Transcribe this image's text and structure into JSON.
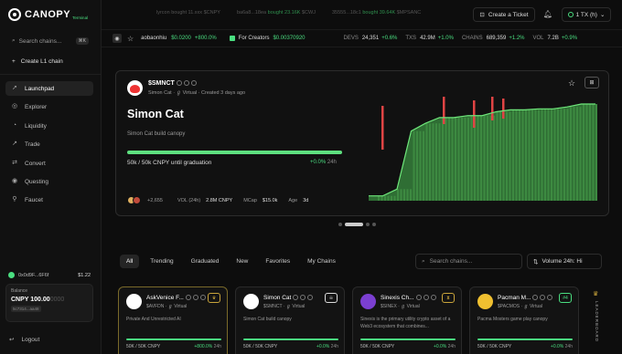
{
  "app": {
    "name": "CANOPY",
    "sub": "Terminal"
  },
  "sidebar": {
    "search_placeholder": "Search chains...",
    "search_shortcut": "⌘K",
    "create_label": "Create L1 chain",
    "items": [
      {
        "label": "Launchpad",
        "icon": "rocket-icon",
        "active": true
      },
      {
        "label": "Explorer",
        "icon": "globe-icon"
      },
      {
        "label": "Liquidity",
        "icon": "drop-icon"
      },
      {
        "label": "Trade",
        "icon": "trend-icon"
      },
      {
        "label": "Convert",
        "icon": "swap-icon"
      },
      {
        "label": "Questing",
        "icon": "target-icon"
      },
      {
        "label": "Faucet",
        "icon": "faucet-icon"
      }
    ],
    "wallet": {
      "address": "0x0d9F...6F6f",
      "balance_usd": "$1.22",
      "balance_label": "Balance",
      "balance_value": "CNPY 100.00",
      "balance_faded": "0000",
      "addr_short": "5c7314...aa48"
    },
    "logout_label": "Logout"
  },
  "ticker": [
    {
      "left": "lyrcon bought 11.xxx $CNPY",
      "right": ""
    },
    {
      "left": "ba6a8...18ea",
      "bought": "bought 23.16K",
      "sym": "$CWJ"
    },
    {
      "left": "35555...18c1",
      "bought": "bought 39.64K",
      "sym": "$MPSANC"
    }
  ],
  "header": {
    "ticket_label": "Create a Ticket",
    "tx_label": "1 TX (h)",
    "tx_caret": "⌄"
  },
  "statbar": {
    "user": "aobaonhiu",
    "user_price": "$0.0200",
    "user_change": "+800.0%",
    "creators_label": "For Creators",
    "creators_price": "$0.00370920",
    "devs_label": "DEVS",
    "devs_val": "24,351",
    "devs_chg": "+0.6%",
    "txs_label": "TXS",
    "txs_val": "42.9M",
    "txs_chg": "+1.0%",
    "chains_label": "CHAINS",
    "chains_val": "689,359",
    "chains_chg": "+1.2%",
    "vol_label": "VOL",
    "vol_val": "7.2B",
    "vol_chg": "+0.9%"
  },
  "featured": {
    "symbol": "$SMNCT",
    "creator": "Simon Cat",
    "virtual_label": "Virtual",
    "created": "Created 3 days ago",
    "name": "Simon Cat",
    "description": "Simon Cat build canopy",
    "progress": 1.0,
    "progress_text": "50k / 50k CNPY until graduation",
    "change_text": "+0.0%",
    "change_period": "24h",
    "holders": "+2,655",
    "vol_label": "VOL (24h)",
    "vol_val": "2.8M CNPY",
    "mcap_label": "MCap",
    "mcap_val": "$15.0k",
    "age_label": "Age",
    "age_val": "3d"
  },
  "filters": {
    "tabs": [
      "All",
      "Trending",
      "Graduated",
      "New",
      "Favorites",
      "My Chains"
    ],
    "active": 0,
    "search_placeholder": "Search chains...",
    "sort_label": "Volume 24h: Hi"
  },
  "cards": [
    {
      "name": "AskVenice F...",
      "symbol": "$AVFDN",
      "virtual": "Virtual",
      "desc": "Private And Unrestricted AI",
      "progress_text": "50K / 50K CNPY",
      "change": "+800.0%",
      "period": "24h",
      "progress": 1.0,
      "badge": "crown-icon",
      "badge_color": "#c9a43a",
      "av_color": "#ffffff"
    },
    {
      "name": "Simon Cat",
      "symbol": "$SMNCT",
      "virtual": "Virtual",
      "desc": "Simon Cat build canopy",
      "progress_text": "50K / 50K CNPY",
      "change": "+0.0%",
      "period": "24h",
      "progress": 1.0,
      "badge": "skull-icon",
      "badge_color": "#dddddd",
      "av_color": "#ffffff"
    },
    {
      "name": "Sinexis Ch...",
      "symbol": "$SINEX",
      "virtual": "Virtual",
      "desc": "Sinexis is the primary utility crypto asset of a Web3 ecosystem that combines...",
      "progress_text": "50K / 50K CNPY",
      "change": "+0.0%",
      "period": "24h",
      "progress": 1.0,
      "badge": "hourglass-icon",
      "badge_color": "#c9a43a",
      "av_color": "#7b3fd1"
    },
    {
      "name": "Pacman M...",
      "symbol": "$PACMOS",
      "virtual": "Virtual",
      "desc": "Pacma Mosters game play canopy",
      "progress_text": "50K / 50K CNPY",
      "change": "+0.0%",
      "period": "24h",
      "progress": 1.0,
      "badge_text": "#4",
      "badge_color": "#4ade80",
      "av_color": "#f0c030"
    }
  ],
  "leaderboard_label": "LEADERBOARD",
  "colors": {
    "accent": "#4ade80",
    "bg": "#0d0d0d",
    "gold": "#c9a43a",
    "red": "#e04444"
  },
  "chart_data": {
    "type": "line",
    "description_series": "Simon Cat price",
    "series": [
      {
        "name": "",
        "values": [
          0.05,
          0.05,
          0.12,
          0.72,
          0.8,
          0.86,
          0.86,
          0.88,
          0.88,
          0.92,
          0.94,
          0.94,
          0.95,
          0.95,
          0.97,
          1.0,
          1.0
        ]
      }
    ]
  }
}
